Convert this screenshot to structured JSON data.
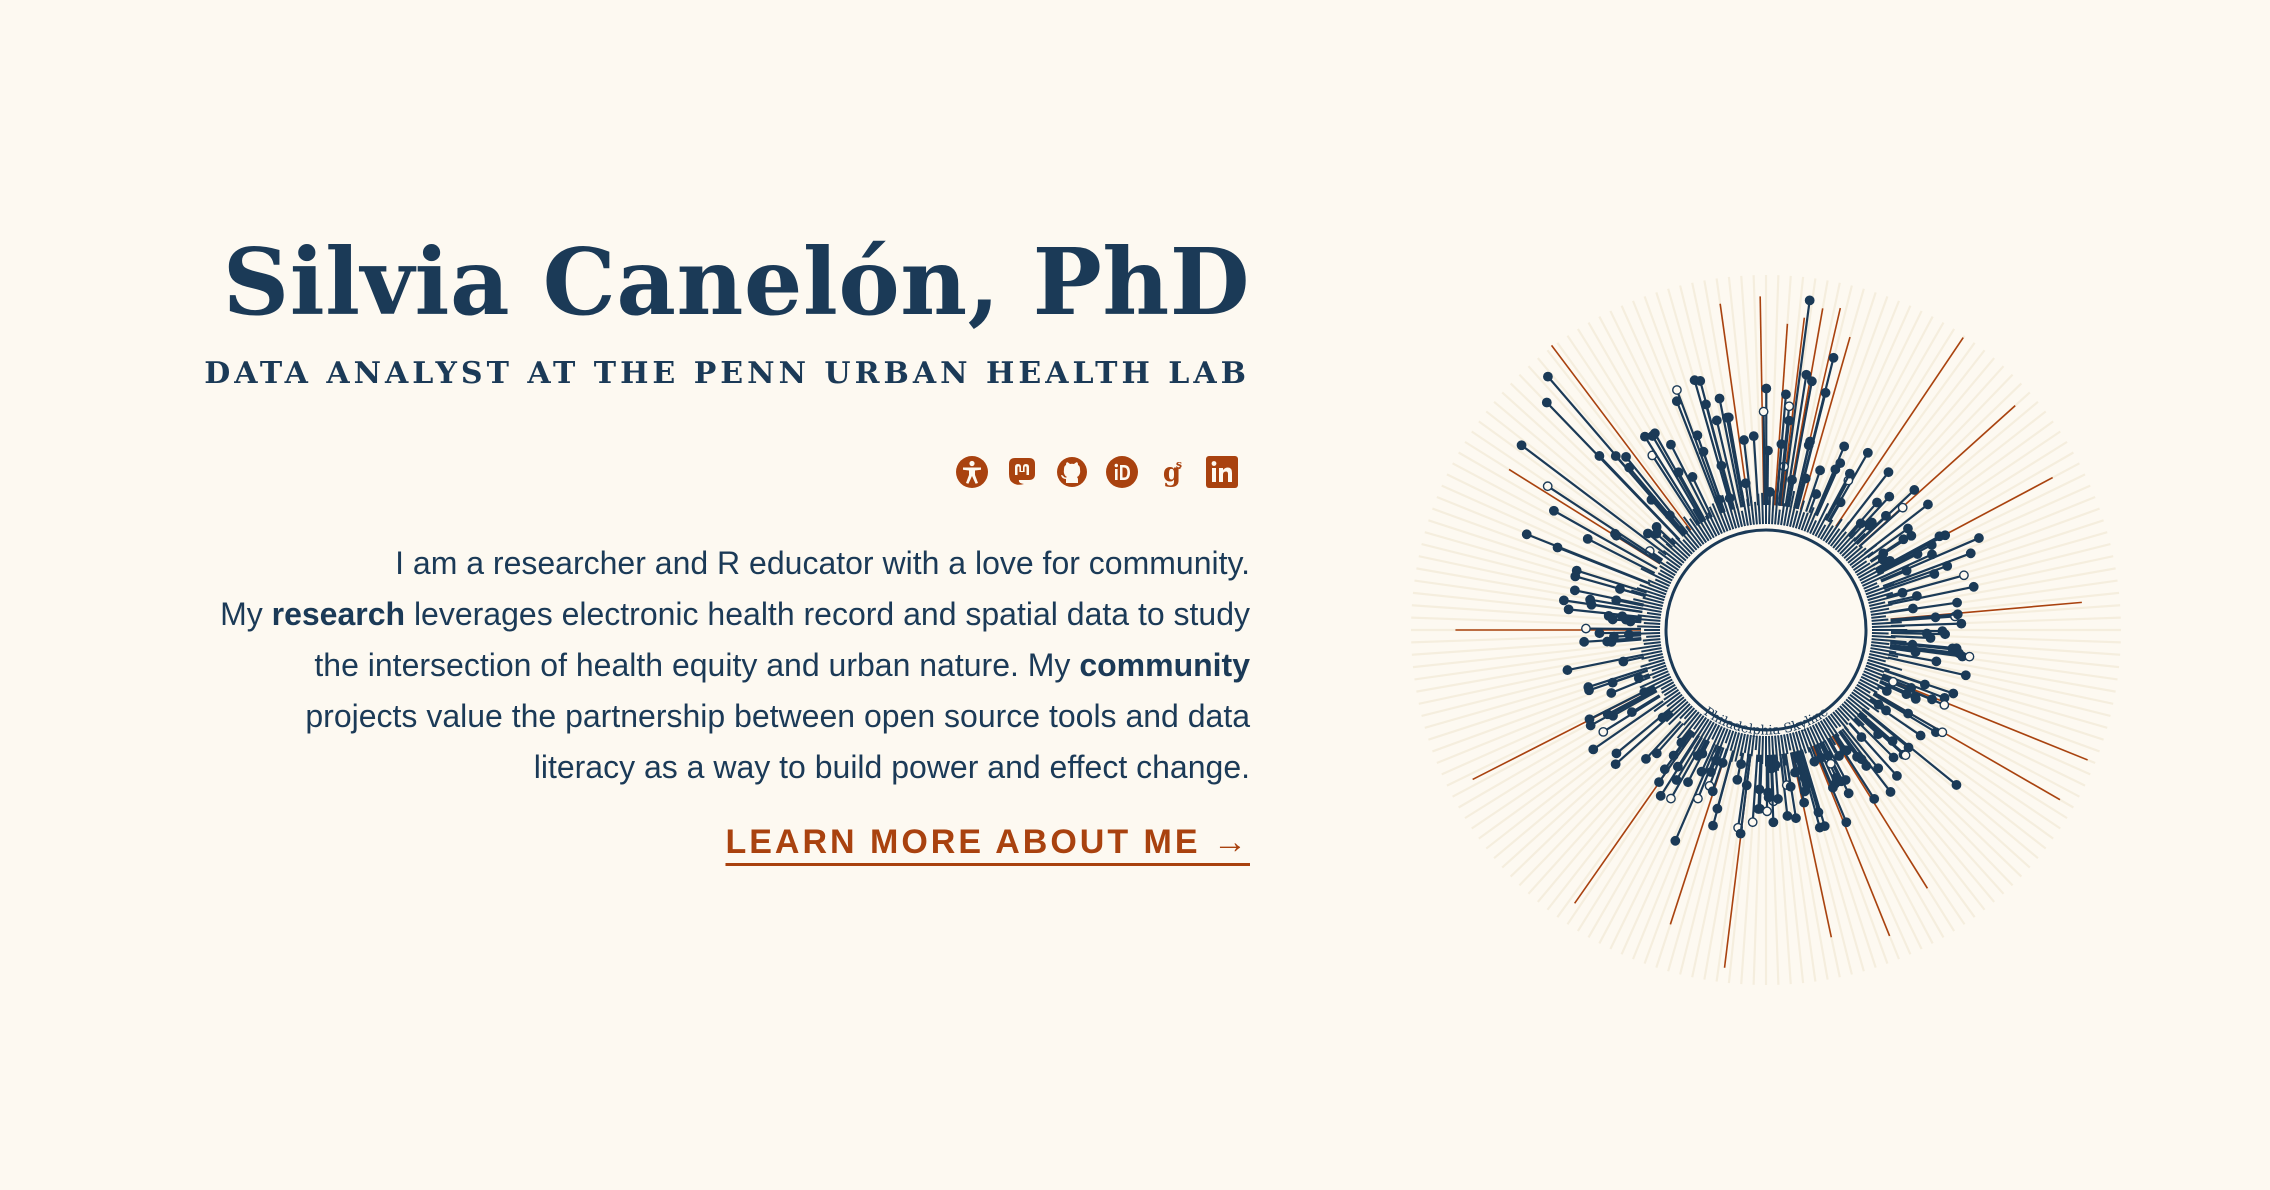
{
  "hero": {
    "name": "Silvia Canelón, PhD",
    "subtitle": "DATA ANALYST AT THE PENN URBAN HEALTH LAB",
    "bio": {
      "line1": "I am a researcher and R educator with a love for community.",
      "line2_pre": "My ",
      "line2_bold": "research",
      "line2_post": " leverages electronic health record and spatial data to study",
      "line3_pre": "the intersection of health equity and urban nature. My ",
      "line3_bold": "community",
      "line4": "projects value the partnership between open source tools and data",
      "line5": "literacy as a way to build power and effect change."
    },
    "cta": "LEARN MORE ABOUT ME →"
  },
  "social": [
    {
      "icon": "accessibility-icon"
    },
    {
      "icon": "mastodon-icon"
    },
    {
      "icon": "github-icon"
    },
    {
      "icon": "orcid-icon"
    },
    {
      "icon": "google-scholar-icon"
    },
    {
      "icon": "linkedin-icon"
    }
  ],
  "visual": {
    "caption": "Philadelphia Skyline"
  },
  "colors": {
    "background": "#fdf9f1",
    "navy": "#1b3a57",
    "accent": "#a9420f",
    "ray_light": "#f3ead7"
  }
}
